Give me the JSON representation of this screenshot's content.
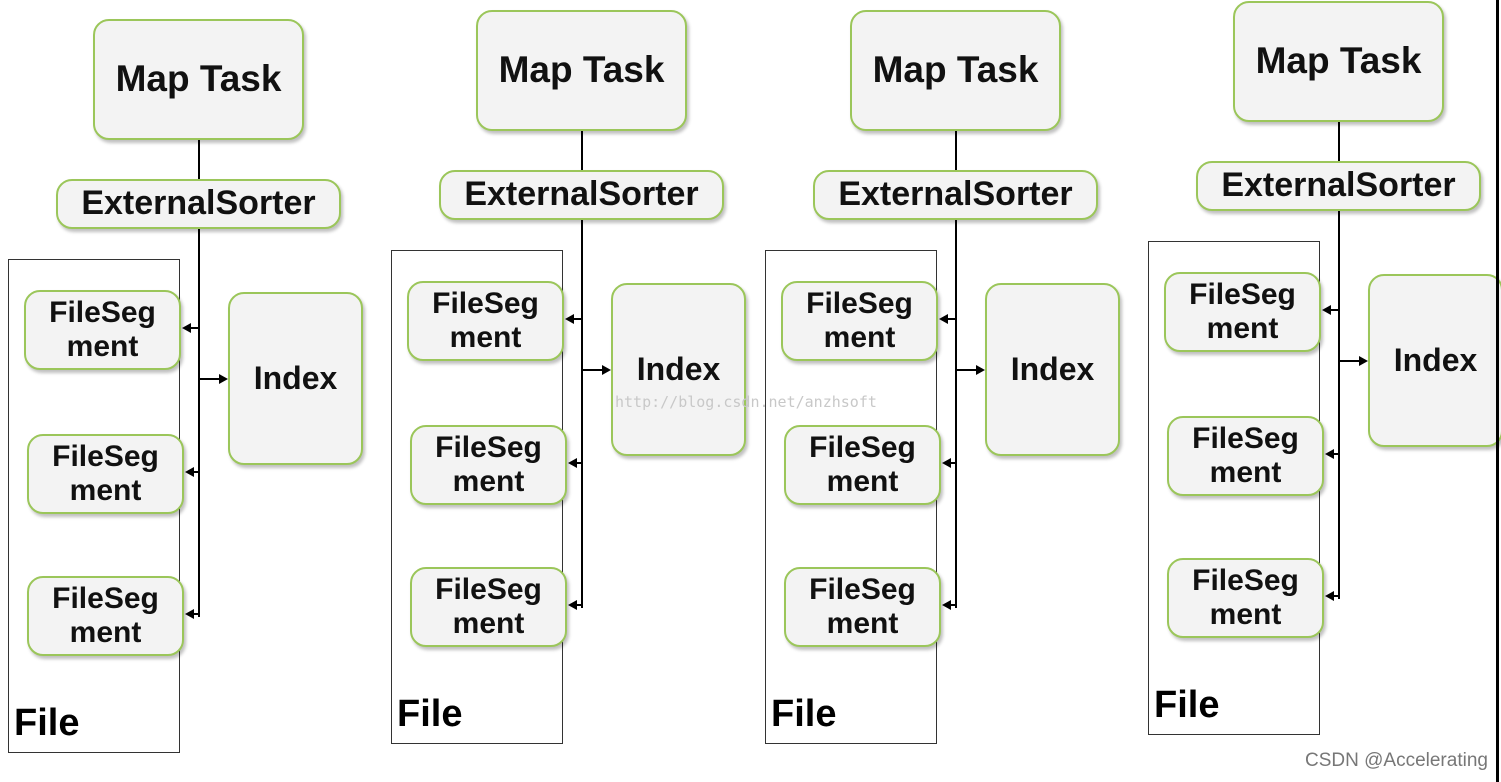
{
  "columns": [
    {
      "map_task": "Map Task",
      "sorter": "ExternalSorter",
      "segments": [
        "FileSeg ment",
        "FileSeg ment",
        "FileSeg ment"
      ],
      "index": "Index",
      "file": "File"
    },
    {
      "map_task": "Map Task",
      "sorter": "ExternalSorter",
      "segments": [
        "FileSeg ment",
        "FileSeg ment",
        "FileSeg ment"
      ],
      "index": "Index",
      "file": "File"
    },
    {
      "map_task": "Map Task",
      "sorter": "ExternalSorter",
      "segments": [
        "FileSeg ment",
        "FileSeg ment",
        "FileSeg ment"
      ],
      "index": "Index",
      "file": "File"
    },
    {
      "map_task": "Map Task",
      "sorter": "ExternalSorter",
      "segments": [
        "FileSeg ment",
        "FileSeg ment",
        "FileSeg ment"
      ],
      "index": "Index",
      "file": "File"
    }
  ],
  "watermark": "http://blog.csdn.net/anzhsoft",
  "credit": "CSDN @Accelerating",
  "colors": {
    "box_border": "#9bc65a",
    "box_fill": "#f3f3f3",
    "line": "#000000"
  }
}
